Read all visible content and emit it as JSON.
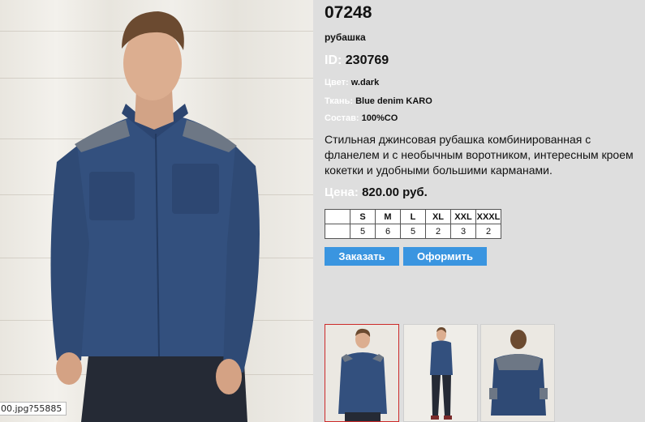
{
  "product": {
    "article": "07248",
    "type": "рубашка",
    "id_label": "ID:",
    "id_value": "230769",
    "color_label": "Цвет:",
    "color_value": "w.dark",
    "fabric_label": "Ткань:",
    "fabric_value": "Blue denim KARO",
    "composition_label": "Состав:",
    "composition_value": "100%CO",
    "description": "Стильная джинсовая рубашка комбинированная с фланелем и с необычным воротником, интересным кроем кокетки и удобными большими карманами.",
    "price_label": "Цена:",
    "price_value": "820.00 руб."
  },
  "sizes": {
    "headers": [
      "",
      "S",
      "M",
      "L",
      "XL",
      "XXL",
      "XXXL"
    ],
    "counts": [
      "",
      "5",
      "6",
      "5",
      "2",
      "3",
      "2"
    ]
  },
  "buttons": {
    "order": "Заказать",
    "checkout": "Оформить"
  },
  "status_url": "00.jpg?55885",
  "colors": {
    "page_bg": "#dedede",
    "button": "#3a95e0",
    "active_thumb_border": "#cc2a2a",
    "label": "#ffffff"
  },
  "thumbnails": [
    "front-view",
    "full-body-view",
    "back-view"
  ]
}
